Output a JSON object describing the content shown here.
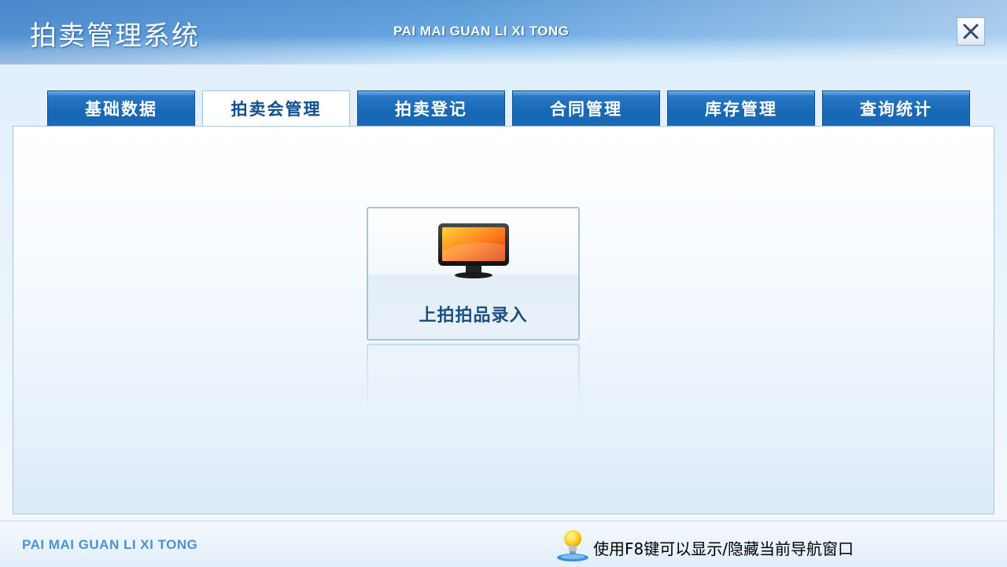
{
  "window": {
    "title": "拍卖管理系统",
    "subtitle": "PAI MAI GUAN LI XI TONG",
    "close_icon": "close-icon"
  },
  "tabs": [
    {
      "label": "基础数据",
      "active": false
    },
    {
      "label": "拍卖会管理",
      "active": true
    },
    {
      "label": "拍卖登记",
      "active": false
    },
    {
      "label": "合同管理",
      "active": false
    },
    {
      "label": "库存管理",
      "active": false
    },
    {
      "label": "查询统计",
      "active": false
    }
  ],
  "main": {
    "tiles": [
      {
        "label": "上拍拍品录入",
        "icon": "monitor-icon"
      }
    ]
  },
  "footer": {
    "brand": "PAI MAI GUAN LI XI TONG",
    "hint": "使用F8键可以显示/隐藏当前导航窗口",
    "hint_icon": "lightbulb-icon"
  },
  "colors": {
    "header_blue": "#5b9ad6",
    "tab_blue": "#1767b5",
    "tab_active_text": "#0e4f8f",
    "tile_label": "#1b4f86",
    "footer_brand": "#4c92d4"
  }
}
